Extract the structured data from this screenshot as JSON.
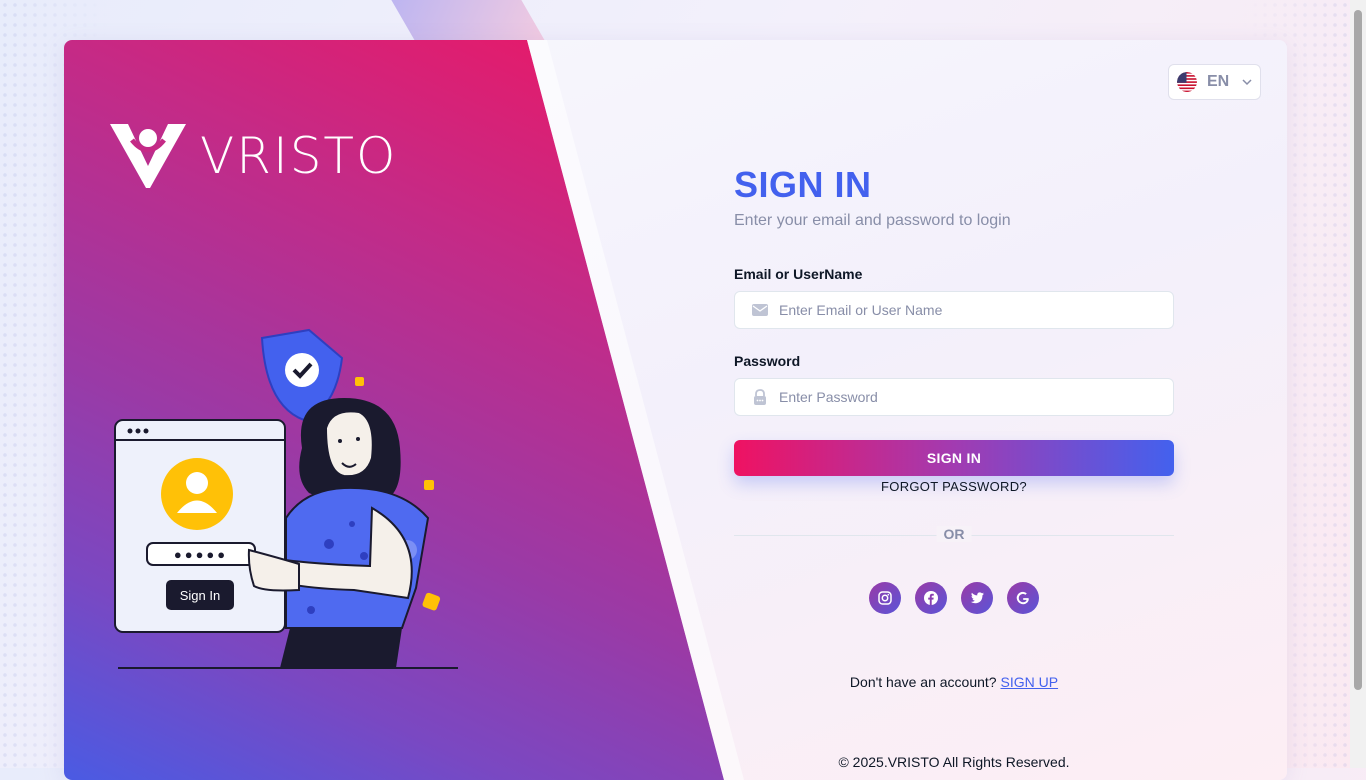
{
  "brand": {
    "name": "VRISTO"
  },
  "language": {
    "code": "EN",
    "flag_icon": "us-flag-icon"
  },
  "form": {
    "title": "SIGN IN",
    "subtitle": "Enter your email and password to login",
    "email_label": "Email or UserName",
    "email_placeholder": "Enter Email or User Name",
    "email_value": "",
    "password_label": "Password",
    "password_placeholder": "Enter Password",
    "password_value": "",
    "submit_label": "SIGN IN",
    "forgot_label": "FORGOT PASSWORD?",
    "or_label": "OR"
  },
  "socials": [
    {
      "name": "instagram",
      "icon": "instagram-icon"
    },
    {
      "name": "facebook",
      "icon": "facebook-icon"
    },
    {
      "name": "twitter",
      "icon": "twitter-icon"
    },
    {
      "name": "google",
      "icon": "google-icon"
    }
  ],
  "signup": {
    "prompt": "Don't have an account?",
    "link_label": "SIGN UP"
  },
  "footer": {
    "copyright": "© 2025.VRISTO All Rights Reserved."
  },
  "illustration": {
    "window_button_label": "Sign In",
    "password_mask": "●●●●●"
  },
  "colors": {
    "primary": "#4361ee",
    "accent": "#ef1262",
    "text": "#0e1726",
    "muted": "#888ea8"
  }
}
